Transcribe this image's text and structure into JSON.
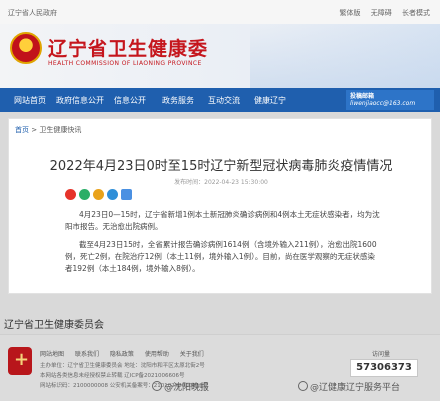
{
  "topbar": {
    "left": "辽宁省人民政府",
    "right_items": [
      "繁体版",
      "无障碍",
      "长者模式"
    ]
  },
  "header": {
    "title": "辽宁省卫生健康委",
    "subtitle": "HEALTH COMMISSION OF LIAONING PROVINCE"
  },
  "nav": {
    "items": [
      "网站首页",
      "政府信息公开",
      "信息公开",
      "政务服务",
      "互动交流",
      "健康辽宁"
    ],
    "mail_title": "投稿邮箱",
    "mail_address": "liwenjiaocc@163.com"
  },
  "breadcrumb": {
    "home": "首页",
    "current": "卫生健康快讯"
  },
  "article": {
    "title": "2022年4月23日0时至15时辽宁新型冠状病毒肺炎疫情情况",
    "meta": "发布时间：2022-04-23 15:30:00",
    "paragraphs": [
      "4月23日0—15时，辽宁省新增1例本土新冠肺炎确诊病例和4例本土无症状感染者，均为沈",
      "阳市报告。无治愈出院病例。",
      "截至4月23日15时，全省累计报告确诊病例1614例（含境外输入211例），治愈出院1600",
      "例，死亡2例，在院治疗12例（本土11例，境外输入1例）。目前，尚在医学观察的无症状感染",
      "者192例（本土184例，境外输入8例）。"
    ]
  },
  "footer": {
    "org_title": "辽宁省卫生健康委员会",
    "links": [
      "网站地图",
      "联系我们",
      "隐私政策",
      "使用帮助",
      "关于我们"
    ],
    "line1": "主办单位：辽宁省卫生健康委员会    地址：沈阳市和平区太原北街2号",
    "line2": "本网站各类信息未经授权禁止转载    辽ICP备2021006606号",
    "line3": "网站标识码：2100000008    公安机关备案号：21010202000619号",
    "visits_label": "访问量",
    "visits": "57306373"
  },
  "watermarks": {
    "left": "@沈阳晚报",
    "right": "@辽健康辽宁服务平台"
  },
  "colors": {
    "nav_blue": "#1f5fae",
    "brand_red": "#c5161d",
    "page_bg": "#d9d9d9"
  }
}
